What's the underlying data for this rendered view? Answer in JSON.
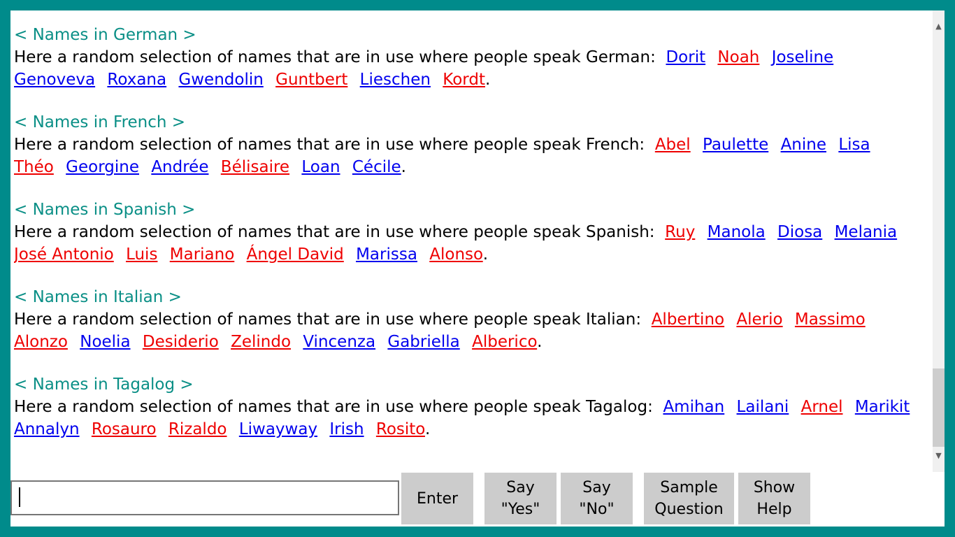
{
  "sections": [
    {
      "heading": "< Names in German >",
      "intro": "Here a random selection of names that are in use where people speak German:",
      "names": [
        {
          "text": "Dorit",
          "color": "blue"
        },
        {
          "text": "Noah",
          "color": "red"
        },
        {
          "text": "Joseline",
          "color": "blue"
        },
        {
          "text": "Genoveva",
          "color": "blue"
        },
        {
          "text": "Roxana",
          "color": "blue"
        },
        {
          "text": "Gwendolin",
          "color": "blue"
        },
        {
          "text": "Guntbert",
          "color": "red"
        },
        {
          "text": "Lieschen",
          "color": "blue"
        },
        {
          "text": "Kordt",
          "color": "red"
        }
      ]
    },
    {
      "heading": "< Names in French >",
      "intro": "Here a random selection of names that are in use where people speak French:",
      "names": [
        {
          "text": "Abel",
          "color": "red"
        },
        {
          "text": "Paulette",
          "color": "blue"
        },
        {
          "text": "Anine",
          "color": "blue"
        },
        {
          "text": "Lisa",
          "color": "blue"
        },
        {
          "text": "Théo",
          "color": "red"
        },
        {
          "text": "Georgine",
          "color": "blue"
        },
        {
          "text": "Andrée",
          "color": "blue"
        },
        {
          "text": "Bélisaire",
          "color": "red"
        },
        {
          "text": "Loan",
          "color": "blue"
        },
        {
          "text": "Cécile",
          "color": "blue"
        }
      ]
    },
    {
      "heading": "< Names in Spanish >",
      "intro": "Here a random selection of names that are in use where people speak Spanish:",
      "names": [
        {
          "text": "Ruy",
          "color": "red"
        },
        {
          "text": "Manola",
          "color": "blue"
        },
        {
          "text": "Diosa",
          "color": "blue"
        },
        {
          "text": "Melania",
          "color": "blue"
        },
        {
          "text": "José Antonio",
          "color": "red"
        },
        {
          "text": "Luis",
          "color": "red"
        },
        {
          "text": "Mariano",
          "color": "red"
        },
        {
          "text": "Ángel David",
          "color": "red"
        },
        {
          "text": "Marissa",
          "color": "blue"
        },
        {
          "text": "Alonso",
          "color": "red"
        }
      ]
    },
    {
      "heading": "< Names in Italian >",
      "intro": "Here a random selection of names that are in use where people speak Italian:",
      "names": [
        {
          "text": "Albertino",
          "color": "red"
        },
        {
          "text": "Alerio",
          "color": "red"
        },
        {
          "text": "Massimo",
          "color": "red"
        },
        {
          "text": "Alonzo",
          "color": "red"
        },
        {
          "text": "Noelia",
          "color": "blue"
        },
        {
          "text": "Desiderio",
          "color": "red"
        },
        {
          "text": "Zelindo",
          "color": "red"
        },
        {
          "text": "Vincenza",
          "color": "blue"
        },
        {
          "text": "Gabriella",
          "color": "blue"
        },
        {
          "text": "Alberico",
          "color": "red"
        }
      ]
    },
    {
      "heading": "< Names in Tagalog >",
      "intro": "Here a random selection of names that are in use where people speak Tagalog:",
      "names": [
        {
          "text": "Amihan",
          "color": "blue"
        },
        {
          "text": "Lailani",
          "color": "blue"
        },
        {
          "text": "Arnel",
          "color": "red"
        },
        {
          "text": "Marikit",
          "color": "blue"
        },
        {
          "text": "Annalyn",
          "color": "blue"
        },
        {
          "text": "Rosauro",
          "color": "red"
        },
        {
          "text": "Rizaldo",
          "color": "red"
        },
        {
          "text": "Liwayway",
          "color": "blue"
        },
        {
          "text": "Irish",
          "color": "blue"
        },
        {
          "text": "Rosito",
          "color": "red"
        }
      ]
    }
  ],
  "input": {
    "value": ""
  },
  "buttons": {
    "enter": "Enter",
    "say_yes": "Say\n\"Yes\"",
    "say_no": "Say\n\"No\"",
    "sample_question": "Sample\nQuestion",
    "show_help": "Show\nHelp"
  },
  "scrollbar": {
    "up_icon": "chevron-up-icon",
    "down_icon": "chevron-down-icon"
  },
  "colors": {
    "background": "#008b8b",
    "heading": "#0a8f86",
    "name_blue": "#0000ee",
    "name_red": "#ee0000",
    "button": "#cccccc"
  }
}
